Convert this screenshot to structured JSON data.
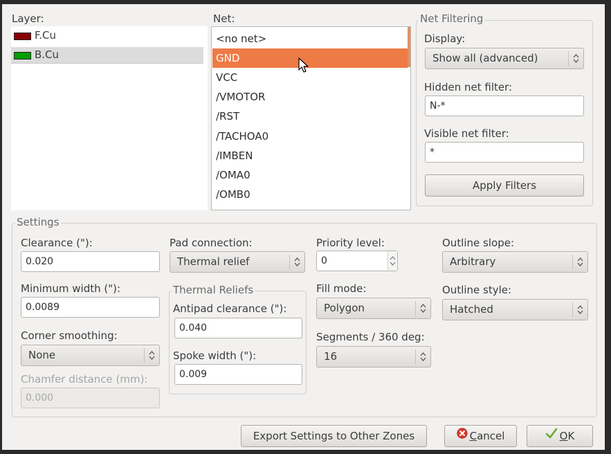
{
  "layer": {
    "label": "Layer:",
    "items": [
      {
        "name": "F.Cu",
        "color": "#8b0000"
      },
      {
        "name": "B.Cu",
        "color": "#00a000"
      }
    ]
  },
  "net": {
    "label": "Net:",
    "items": [
      "<no net>",
      "GND",
      "VCC",
      "/VMOTOR",
      "/RST",
      "/TACHOA0",
      "/IMBEN",
      "/OMA0",
      "/OMB0"
    ],
    "selected": "GND"
  },
  "net_filtering": {
    "title": "Net Filtering",
    "display_label": "Display:",
    "display_value": "Show all (advanced)",
    "hidden_label": "Hidden net filter:",
    "hidden_value": "N-*",
    "visible_label": "Visible net filter:",
    "visible_value": "*",
    "apply_button": "Apply Filters"
  },
  "settings": {
    "title": "Settings",
    "clearance_label": "Clearance (\"):",
    "clearance_value": "0.020",
    "min_width_label": "Minimum width (\"):",
    "min_width_value": "0.0089",
    "corner_label": "Corner smoothing:",
    "corner_value": "None",
    "chamfer_label": "Chamfer distance (mm):",
    "chamfer_value": "0.000",
    "pad_label": "Pad connection:",
    "pad_value": "Thermal relief",
    "thermal_title": "Thermal Reliefs",
    "antipad_label": "Antipad clearance (\"):",
    "antipad_value": "0.040",
    "spoke_label": "Spoke width (\"):",
    "spoke_value": "0.009",
    "priority_label": "Priority level:",
    "priority_value": "0",
    "fill_label": "Fill mode:",
    "fill_value": "Polygon",
    "segments_label": "Segments / 360 deg:",
    "segments_value": "16",
    "slope_label": "Outline slope:",
    "slope_value": "Arbitrary",
    "style_label": "Outline style:",
    "style_value": "Hatched"
  },
  "buttons": {
    "export": "Export Settings to Other Zones",
    "cancel_rest": "ancel",
    "ok_rest": "K"
  },
  "colors": {
    "selection": "#ee7a46",
    "dialog_bg": "#f2f1f0"
  }
}
